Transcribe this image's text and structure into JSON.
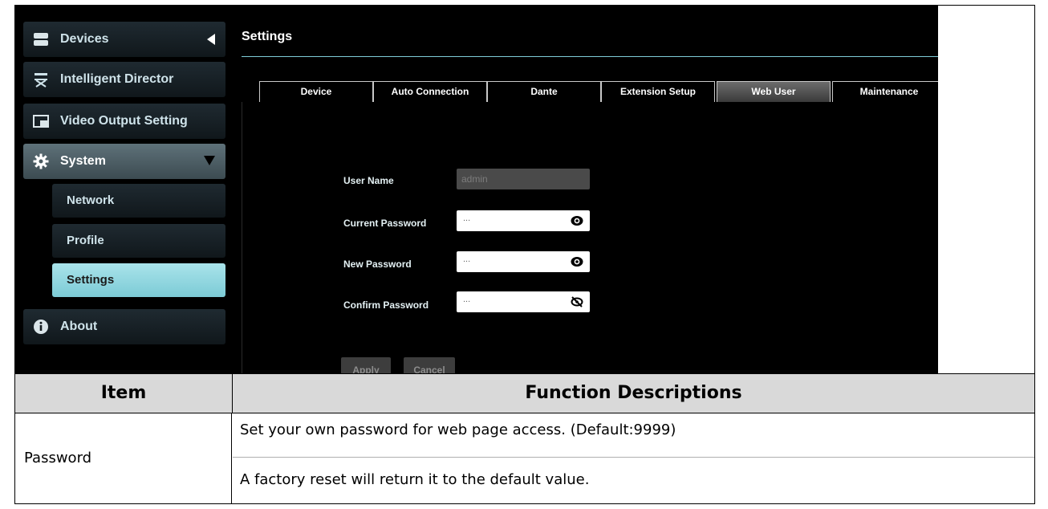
{
  "sidebar": {
    "devices": "Devices",
    "intelligent_director": "Intelligent Director",
    "video_output_setting": "Video Output Setting",
    "system": "System",
    "network": "Network",
    "profile": "Profile",
    "settings": "Settings",
    "about": "About"
  },
  "main": {
    "title": "Settings",
    "tabs": [
      "Device",
      "Auto Connection",
      "Dante",
      "Extension Setup",
      "Web User",
      "Maintenance"
    ],
    "active_tab": "Web User"
  },
  "form": {
    "user_name_label": "User Name",
    "user_name_value": "admin",
    "current_password_label": "Current Password",
    "current_password_value": "...",
    "new_password_label": "New Password",
    "new_password_value": "...",
    "confirm_password_label": "Confirm Password",
    "confirm_password_value": "...",
    "apply": "Apply",
    "cancel": "Cancel"
  },
  "table": {
    "header_item": "Item",
    "header_desc": "Function Descriptions",
    "row_item": "Password",
    "row_desc_1": "Set your own password for web page access. (Default:9999)",
    "row_desc_2": "A factory reset will return it to the default value."
  },
  "colors": {
    "accent": "#7fcdd8",
    "active_sub": "#9fdde6",
    "header_bg": "#d9d9d9"
  }
}
